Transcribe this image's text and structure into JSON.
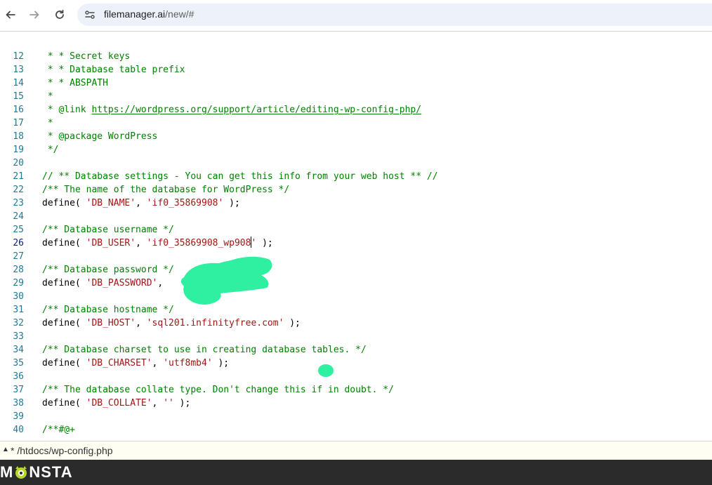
{
  "browser": {
    "url_host": "filemanager.ai",
    "url_path": "/new/#",
    "icons": {
      "back": "back-arrow-icon",
      "forward": "forward-arrow-icon",
      "reload": "reload-icon",
      "site_info": "site-settings-icon"
    }
  },
  "editor": {
    "active_line": "26",
    "lines": [
      {
        "n": "12",
        "text": " * * Secret keys"
      },
      {
        "n": "13",
        "text": " * * Database table prefix"
      },
      {
        "n": "14",
        "text": " * * ABSPATH"
      },
      {
        "n": "15",
        "text": " *"
      },
      {
        "n": "16",
        "pre": " * @link ",
        "link": "https://wordpress.org/support/article/editing-wp-config-php/"
      },
      {
        "n": "17",
        "text": " *"
      },
      {
        "n": "18",
        "text": " * @package WordPress"
      },
      {
        "n": "19",
        "text": " */"
      },
      {
        "n": "20",
        "text": ""
      },
      {
        "n": "21",
        "text": "// ** Database settings - You can get this info from your web host ** //"
      },
      {
        "n": "22",
        "text": "/** The name of the database for WordPress */"
      },
      {
        "n": "23",
        "define_key": "'DB_NAME'",
        "define_val": "'if0_35869908'"
      },
      {
        "n": "24",
        "text": ""
      },
      {
        "n": "25",
        "text": "/** Database username */"
      },
      {
        "n": "26",
        "define_key": "'DB_USER'",
        "define_val_a": "'if0_35869908_wp908",
        "define_val_b": "'"
      },
      {
        "n": "27",
        "text": ""
      },
      {
        "n": "28",
        "text": "/** Database password */"
      },
      {
        "n": "29",
        "define_key": "'DB_PASSWORD'",
        "tail": ");"
      },
      {
        "n": "30",
        "text": ""
      },
      {
        "n": "31",
        "text": "/** Database hostname */"
      },
      {
        "n": "32",
        "define_key": "'DB_HOST'",
        "define_val": "'sql201.infinityfree.com'"
      },
      {
        "n": "33",
        "text": ""
      },
      {
        "n": "34",
        "text": "/** Database charset to use in creating database tables. */"
      },
      {
        "n": "35",
        "define_key": "'DB_CHARSET'",
        "define_val": "'utf8mb4'"
      },
      {
        "n": "36",
        "text": ""
      },
      {
        "n": "37",
        "text": "/** The database collate type. Don't change this if in doubt. */"
      },
      {
        "n": "38",
        "define_key": "'DB_COLLATE'",
        "define_val": "''"
      },
      {
        "n": "39",
        "text": ""
      },
      {
        "n": "40",
        "text": "/**#@+"
      }
    ],
    "define_prefix": "define( ",
    "define_sep": ", ",
    "define_suffix": " );"
  },
  "status": {
    "toggle_icon": "collapse-triangle-icon",
    "file_label": "* /htdocs/wp-config.php"
  },
  "brand": {
    "name_first": "M",
    "name_rest": "NSTA",
    "logo_icon": "monsta-eye-logo-icon",
    "accent_color": "#b6d82b"
  },
  "colors": {
    "line_number": "#237893",
    "comment": "#008000",
    "string": "#a31515",
    "redaction": "#2ef0a0"
  }
}
